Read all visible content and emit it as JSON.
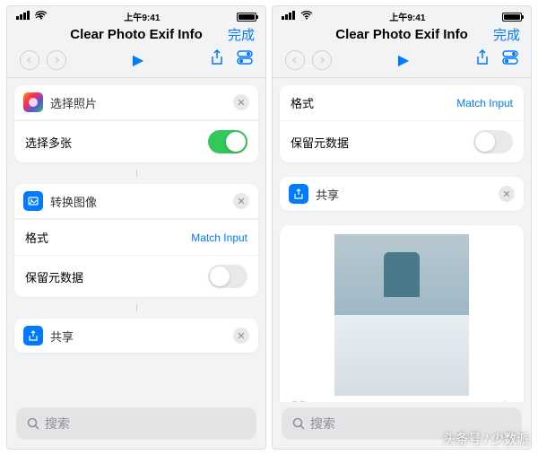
{
  "status_bar": {
    "time": "上午9:41"
  },
  "header": {
    "title": "Clear Photo Exif Info",
    "done": "完成"
  },
  "actions": {
    "select_photo": "选择照片",
    "select_multiple": "选择多张",
    "convert_image": "转换图像",
    "format": "格式",
    "format_value": "Match Input",
    "keep_metadata": "保留元数据",
    "share": "共享"
  },
  "search": {
    "placeholder": "搜索"
  },
  "watermark": "头条号 / 少数派"
}
